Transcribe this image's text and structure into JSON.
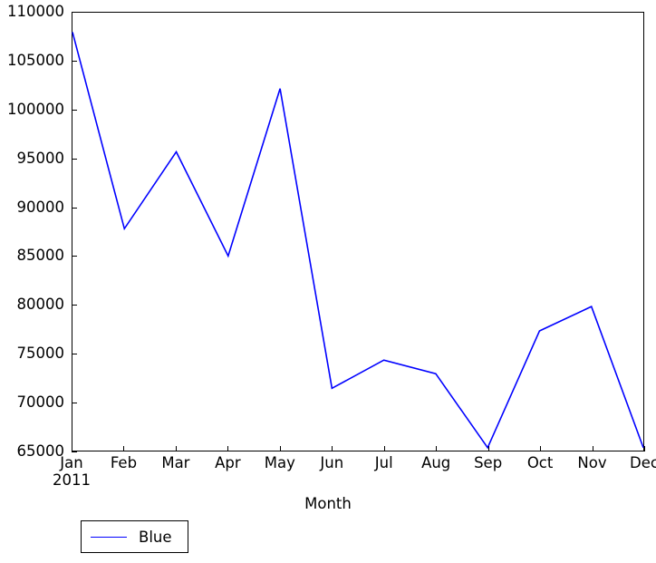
{
  "chart_data": {
    "type": "line",
    "title": "",
    "xlabel": "Month",
    "ylabel": "",
    "categories": [
      "Jan",
      "Feb",
      "Mar",
      "Apr",
      "May",
      "Jun",
      "Jul",
      "Aug",
      "Sep",
      "Oct",
      "Nov",
      "Dec"
    ],
    "x_sublabels": [
      "2011",
      "",
      "",
      "",
      "",
      "",
      "",
      "",
      "",
      "",
      "",
      ""
    ],
    "ylim": [
      65000,
      110000
    ],
    "xlim": [
      0,
      11
    ],
    "ytick_labels": [
      "65000",
      "70000",
      "75000",
      "80000",
      "85000",
      "90000",
      "95000",
      "100000",
      "105000",
      "110000"
    ],
    "ytick_values": [
      65000,
      70000,
      75000,
      80000,
      85000,
      90000,
      95000,
      100000,
      105000,
      110000
    ],
    "grid": false,
    "legend_position": "below-left",
    "series": [
      {
        "name": "Blue",
        "color": "#0000ff",
        "values": [
          108000,
          87800,
          95700,
          85000,
          102200,
          71400,
          74300,
          72900,
          65300,
          77300,
          79800,
          65300
        ]
      }
    ]
  },
  "legend": {
    "entries": [
      {
        "label": "Blue",
        "color": "#0000ff"
      }
    ]
  }
}
